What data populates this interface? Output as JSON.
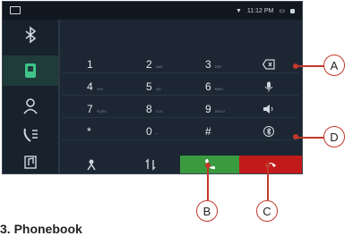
{
  "statusbar": {
    "time": "11:12 PM"
  },
  "keypad": {
    "keys": [
      {
        "label": "1",
        "sub": ""
      },
      {
        "label": "2",
        "sub": "ABC"
      },
      {
        "label": "3",
        "sub": "DEF"
      },
      {
        "label": "4",
        "sub": "GHI"
      },
      {
        "label": "5",
        "sub": "JKL"
      },
      {
        "label": "6",
        "sub": "MNO"
      },
      {
        "label": "7",
        "sub": "PQRS"
      },
      {
        "label": "8",
        "sub": "TUV"
      },
      {
        "label": "9",
        "sub": "WXYZ"
      },
      {
        "label": "*",
        "sub": ""
      },
      {
        "label": "0",
        "sub": "+"
      },
      {
        "label": "#",
        "sub": ""
      }
    ]
  },
  "callouts": {
    "a": "A",
    "b": "B",
    "c": "C",
    "d": "D"
  },
  "caption": "3. Phonebook",
  "colors": {
    "call": "#3a9a3f",
    "end": "#c21a1a",
    "accent": "#3ec48a",
    "callout": "#c0392b"
  }
}
